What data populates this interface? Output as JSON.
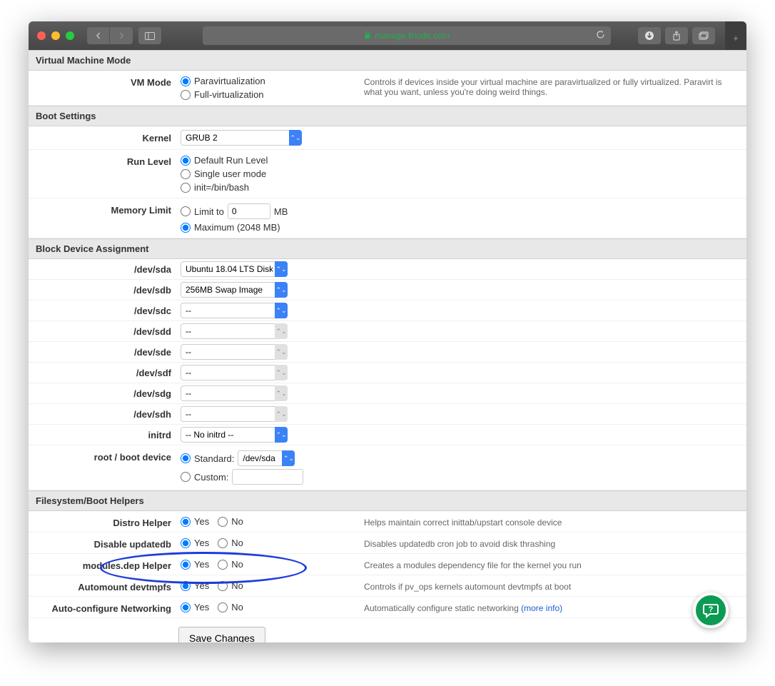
{
  "browser": {
    "url": "manage.linode.com"
  },
  "sections": {
    "vmm": {
      "title": "Virtual Machine Mode",
      "vm_mode": {
        "label": "VM Mode",
        "options": [
          "Paravirtualization",
          "Full-virtualization"
        ],
        "selected": 0,
        "desc": "Controls if devices inside your virtual machine are paravirtualized or fully virtualized. Paravirt is what you want, unless you're doing weird things."
      }
    },
    "boot": {
      "title": "Boot Settings",
      "kernel": {
        "label": "Kernel",
        "value": "GRUB 2"
      },
      "run_level": {
        "label": "Run Level",
        "options": [
          "Default Run Level",
          "Single user mode",
          "init=/bin/bash"
        ],
        "selected": 0
      },
      "memory_limit": {
        "label": "Memory Limit",
        "limit_to": "Limit to",
        "limit_value": "0",
        "mb": "MB",
        "maximum": "Maximum (2048 MB)",
        "selected": 1
      }
    },
    "block": {
      "title": "Block Device Assignment",
      "devices": [
        {
          "label": "/dev/sda",
          "value": "Ubuntu 18.04 LTS Disk",
          "blue": true
        },
        {
          "label": "/dev/sdb",
          "value": "256MB Swap Image",
          "blue": true
        },
        {
          "label": "/dev/sdc",
          "value": "--",
          "blue": true
        },
        {
          "label": "/dev/sdd",
          "value": "--",
          "blue": false
        },
        {
          "label": "/dev/sde",
          "value": "--",
          "blue": false
        },
        {
          "label": "/dev/sdf",
          "value": "--",
          "blue": false
        },
        {
          "label": "/dev/sdg",
          "value": "--",
          "blue": false
        },
        {
          "label": "/dev/sdh",
          "value": "--",
          "blue": false
        }
      ],
      "initrd": {
        "label": "initrd",
        "value": "-- No initrd --"
      },
      "root": {
        "label": "root / boot device",
        "standard": "Standard:",
        "standard_value": "/dev/sda",
        "custom": "Custom:",
        "selected": 0
      }
    },
    "helpers": {
      "title": "Filesystem/Boot Helpers",
      "yes": "Yes",
      "no": "No",
      "rows": [
        {
          "label": "Distro Helper",
          "desc": "Helps maintain correct inittab/upstart console device"
        },
        {
          "label": "Disable updatedb",
          "desc": "Disables updatedb cron job to avoid disk thrashing"
        },
        {
          "label": "modules.dep Helper",
          "desc": "Creates a modules dependency file for the kernel you run"
        },
        {
          "label": "Automount devtmpfs",
          "desc": "Controls if pv_ops kernels automount devtmpfs at boot"
        },
        {
          "label": "Auto-configure Networking",
          "desc": "Automatically configure static networking ",
          "link": "(more info)"
        }
      ]
    }
  },
  "save_button": "Save Changes"
}
